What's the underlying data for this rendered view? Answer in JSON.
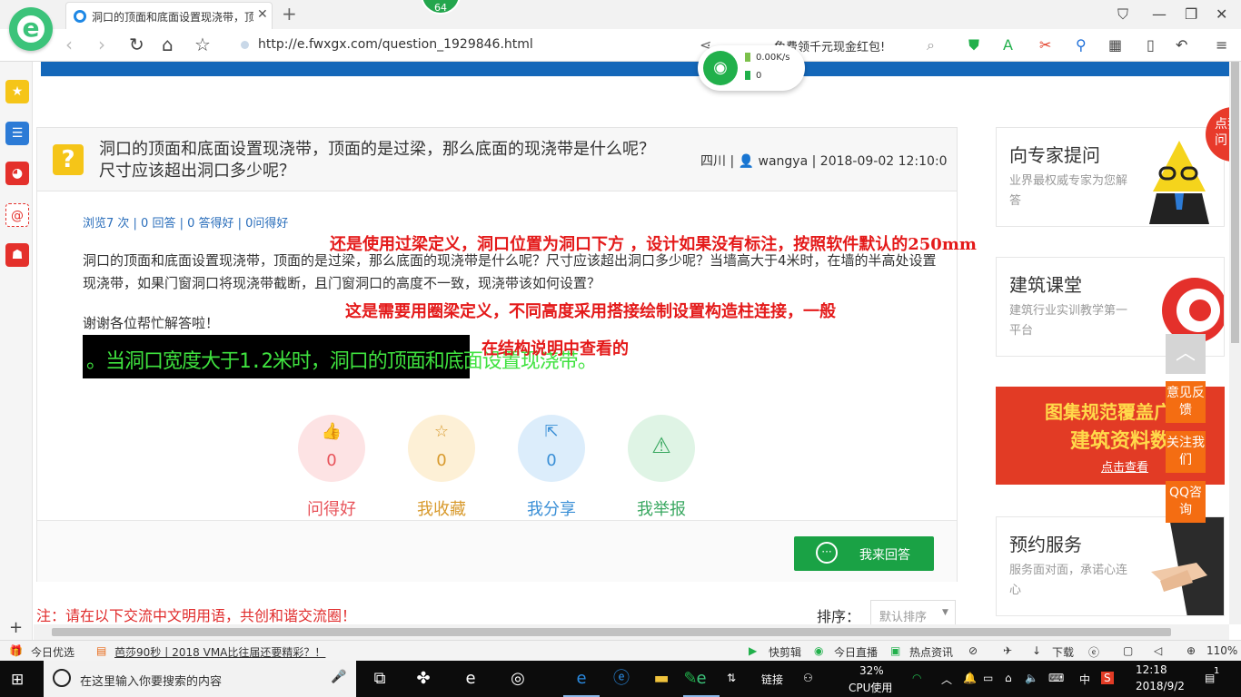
{
  "browser": {
    "tab_title": "洞口的顶面和底面设置现浇带，顶",
    "badge": "64",
    "url_main": "http://e.fwxgx.com/question_1929846.html",
    "promo_text": "免费领千元现金红包!",
    "speed_down": "0.00K/s",
    "speed_up": "0"
  },
  "question": {
    "title": "洞口的顶面和底面设置现浇带，顶面的是过梁，那么底面的现浇带是什么呢？尺寸应该超出洞口多少呢？",
    "meta_region": "四川",
    "meta_user": "wangya",
    "meta_time": "2018-09-02 12:10:0",
    "stats": "浏览7 次 | 0 回答 | 0 答得好 | 0问得好",
    "body": "洞口的顶面和底面设置现浇带，顶面的是过梁，那么底面的现浇带是什么呢？尺寸应该超出洞口多少呢？当墙高大于4米时，在墙的半高处设置现浇带，如果门窗洞口将现浇带截断，且门窗洞口的高度不一致，现浇带该如何设置？",
    "thanks": "谢谢各位帮忙解答啦！",
    "image_text": "。当洞口宽度大于1.2米时，洞口的顶面和底面设置现浇带。"
  },
  "actions": [
    {
      "label": "问得好",
      "count": "0",
      "icon": "thumbs-up-icon",
      "color": "#e8535a",
      "bg": "#fde3e4"
    },
    {
      "label": "我收藏",
      "count": "0",
      "icon": "star-icon",
      "color": "#d89a2d",
      "bg": "#fdf0d6"
    },
    {
      "label": "我分享",
      "count": "0",
      "icon": "share-icon",
      "color": "#3a8fd6",
      "bg": "#dcedfb"
    },
    {
      "label": "我举报",
      "count": "",
      "icon": "warning-icon",
      "color": "#3aa861",
      "bg": "#dff4e5"
    }
  ],
  "answer_button": "我来回答",
  "notice": "注：请在以下交流中文明用语，共创和谐交流圈！",
  "sort": {
    "label": "排序：",
    "selected": "默认排序"
  },
  "annotations": [
    "还是使用过梁定义，洞口位置为洞口下方 ，设计如果没有标注，按照软件默认的250mm",
    "这是需要用圈梁定义，不同高度采用搭接绘制设置构造柱连接，一般",
    "在结构说明中查看的"
  ],
  "sidebar_cards": {
    "expert": {
      "title": "向专家提问",
      "desc": "业界最权威专家为您解答"
    },
    "class": {
      "title": "建筑课堂",
      "desc": "建筑行业实训教学第一平台"
    },
    "banner": {
      "line1": "图集规范覆盖广",
      "line2": "建筑资料数",
      "line3": "点击查看"
    },
    "service": {
      "title": "预约服务",
      "desc": "服务面对面，承诺心连心"
    },
    "corner": "点我提问"
  },
  "float_buttons": [
    "意见反馈",
    "关注我们",
    "QQ咨询"
  ],
  "statusbar": {
    "today": "今日优选",
    "news": "芭莎90秒丨2018 VMA比往届还要精彩？！",
    "quickcut": "快剪辑",
    "live": "今日直播",
    "hot": "热点资讯",
    "download": "下载",
    "zoom": "110%"
  },
  "taskbar": {
    "search_placeholder": "在这里输入你要搜索的内容",
    "link": "链接",
    "cpu": "32%",
    "cpu_label": "CPU使用",
    "ime": "中",
    "time": "12:18",
    "date": "2018/9/2",
    "notifications": "1"
  },
  "colors": {
    "accent_green": "#1aa245",
    "brand_blue": "#1467b9",
    "annotation_red": "#e41a1a",
    "float_orange": "#f46d12"
  }
}
